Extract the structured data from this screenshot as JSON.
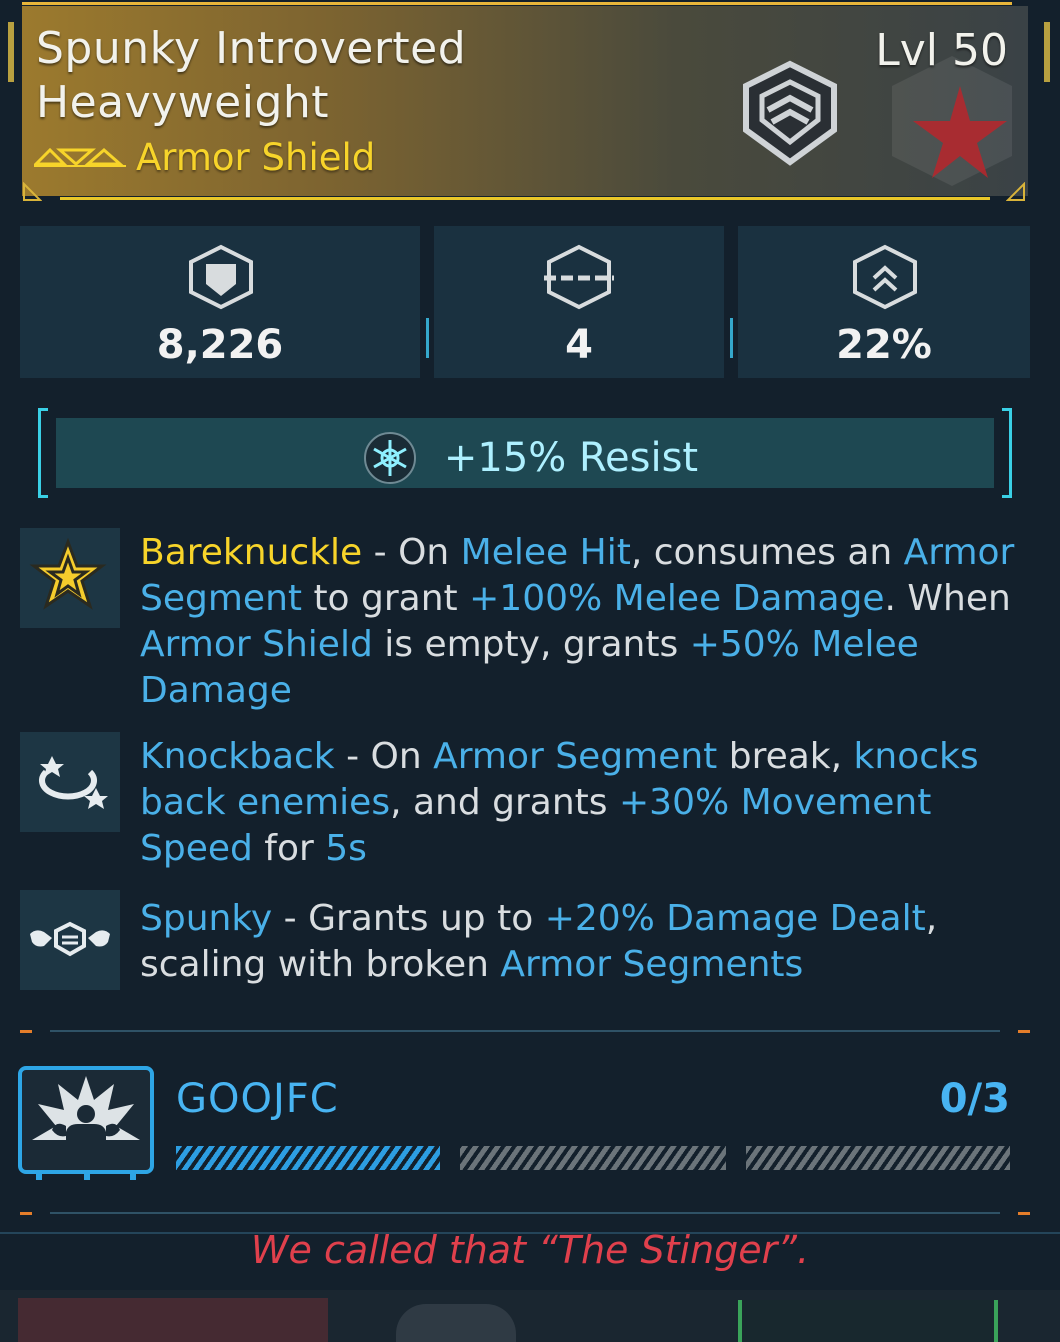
{
  "item": {
    "name_line1": "Spunky Introverted",
    "name_line2": "Heavyweight",
    "level": "Lvl 50",
    "type": "Armor Shield"
  },
  "stats": [
    {
      "icon": "shield-icon",
      "value": "8,226"
    },
    {
      "icon": "armor-segment-icon",
      "value": "4"
    },
    {
      "icon": "resist-chevron-icon",
      "value": "22%"
    }
  ],
  "resist": {
    "icon": "cryo-icon",
    "text": "+15% Resist"
  },
  "perks": [
    {
      "icon": "star-icon",
      "parts": [
        {
          "t": "Bareknuckle",
          "c": "gold"
        },
        {
          "t": " - On ",
          "c": ""
        },
        {
          "t": "Melee Hit",
          "c": "hl"
        },
        {
          "t": ", consumes an ",
          "c": ""
        },
        {
          "t": "Armor Segment",
          "c": "hl"
        },
        {
          "t": " to grant ",
          "c": ""
        },
        {
          "t": "+100% Melee Damage",
          "c": "hl"
        },
        {
          "t": ". When ",
          "c": ""
        },
        {
          "t": "Armor Shield",
          "c": "hl"
        },
        {
          "t": " is empty, grants ",
          "c": ""
        },
        {
          "t": "+50% Melee Damage",
          "c": "hl"
        }
      ]
    },
    {
      "icon": "knockback-icon",
      "parts": [
        {
          "t": "Knockback",
          "c": "hl"
        },
        {
          "t": " - On ",
          "c": ""
        },
        {
          "t": "Armor Segment",
          "c": "hl"
        },
        {
          "t": " break, ",
          "c": ""
        },
        {
          "t": "knocks back enemies",
          "c": "hl"
        },
        {
          "t": ", and grants ",
          "c": ""
        },
        {
          "t": "+30% Movement Speed",
          "c": "hl"
        },
        {
          "t": " for ",
          "c": ""
        },
        {
          "t": "5s",
          "c": "hl"
        }
      ]
    },
    {
      "icon": "flex-arms-icon",
      "parts": [
        {
          "t": "Spunky",
          "c": "hl"
        },
        {
          "t": " - Grants up to ",
          "c": ""
        },
        {
          "t": "+20% Damage Dealt",
          "c": "hl"
        },
        {
          "t": ", scaling with broken ",
          "c": ""
        },
        {
          "t": "Armor Segments",
          "c": "hl"
        }
      ]
    }
  ],
  "challenge": {
    "name": "GOOJFC",
    "progress": "0/3",
    "completed_fraction": 0.33
  },
  "footer_quote": "We called that “The Stinger”.",
  "colors": {
    "accent_gold": "#f7d42a",
    "highlight_blue": "#4ab0e8",
    "quote_red": "#e0404c"
  }
}
